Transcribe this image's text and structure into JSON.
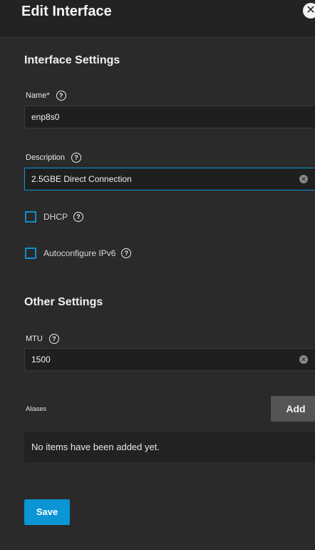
{
  "dialog": {
    "title": "Edit Interface",
    "close_glyph": "✕"
  },
  "interface_settings": {
    "section_title": "Interface Settings",
    "name": {
      "label": "Name*",
      "value": "enp8s0"
    },
    "description": {
      "label": "Description",
      "value": "2.5GBE Direct Connection"
    },
    "dhcp": {
      "label": "DHCP",
      "checked": false
    },
    "autoconfigure_ipv6": {
      "label": "Autoconfigure IPv6",
      "checked": false
    }
  },
  "other_settings": {
    "section_title": "Other Settings",
    "mtu": {
      "label": "MTU",
      "value": "1500"
    }
  },
  "aliases": {
    "label": "Aliases",
    "add_label": "Add",
    "empty_text": "No items have been added yet."
  },
  "actions": {
    "save_label": "Save"
  },
  "icons": {
    "help": "?",
    "clear": "✕"
  },
  "colors": {
    "accent": "#0a95d5",
    "background": "#2a2a2a",
    "field": "#1f1f1f"
  }
}
